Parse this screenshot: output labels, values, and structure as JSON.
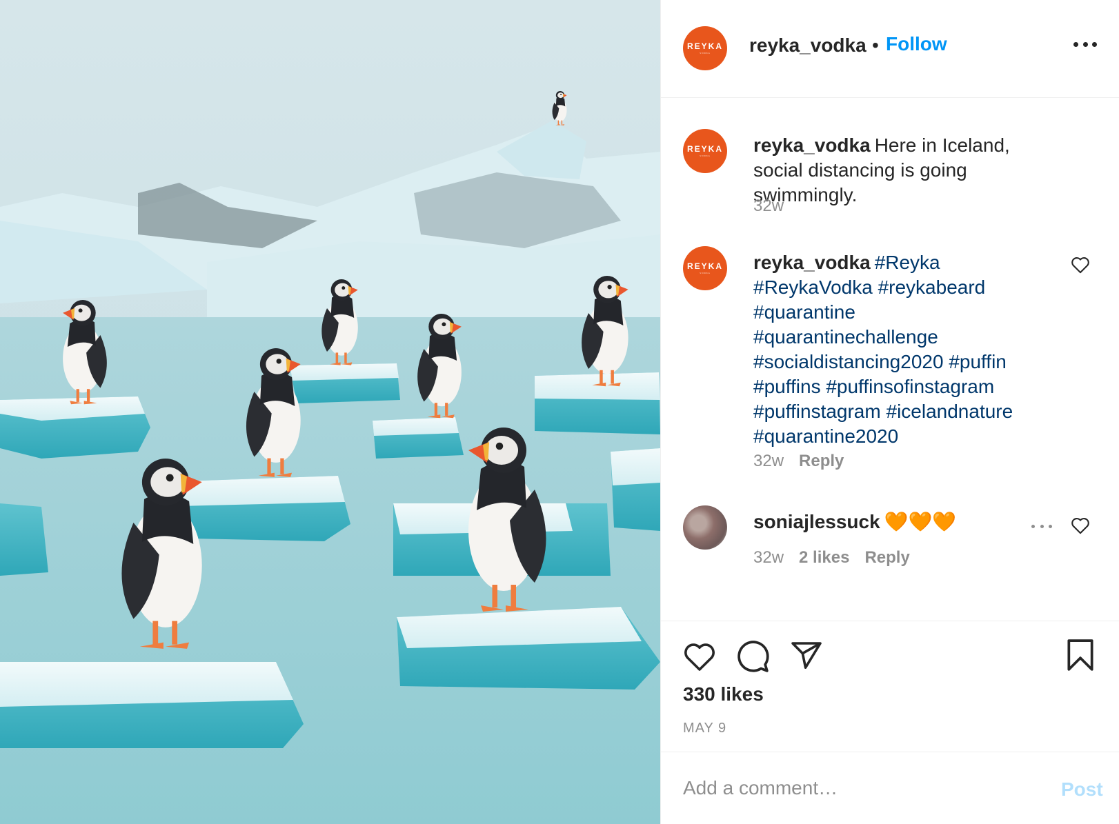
{
  "post": {
    "image_alt": "Puffins standing on floating ice floes in an icy Icelandic lagoon",
    "colors": {
      "accent": "#0095f6",
      "brand": "#e8561c",
      "hashtag": "#00376b",
      "muted": "#8e8e8e",
      "post_disabled": "#b2dffc"
    }
  },
  "header": {
    "avatar_wordmark": "REYKA",
    "avatar_subtext": "VODKA",
    "username": "reyka_vodka",
    "separator": "•",
    "follow_label": "Follow",
    "more_icon": "more-horizontal-icon"
  },
  "caption": {
    "username": "reyka_vodka",
    "text": "Here in Iceland, social distancing is going swimmingly.",
    "time": "32w"
  },
  "comments": [
    {
      "username": "reyka_vodka",
      "hashtags": [
        "#Reyka",
        "#ReykaVodka",
        "#reykabeard",
        "#quarantine",
        "#quarantinechallenge",
        "#socialdistancing2020",
        "#puffin",
        "#puffins",
        "#puffinsofinstagram",
        "#puffinstagram",
        "#icelandnature",
        "#quarantine2020"
      ],
      "time": "32w",
      "reply_label": "Reply"
    },
    {
      "username": "soniajlessuck",
      "text": "🧡🧡🧡",
      "time": "32w",
      "likes": "2 likes",
      "reply_label": "Reply"
    }
  ],
  "actions": {
    "icons": [
      "heart-icon",
      "comment-icon",
      "share-icon",
      "bookmark-icon"
    ],
    "likes": "330 likes",
    "date": "MAY 9"
  },
  "add_comment": {
    "placeholder": "Add a comment…",
    "post_label": "Post"
  }
}
